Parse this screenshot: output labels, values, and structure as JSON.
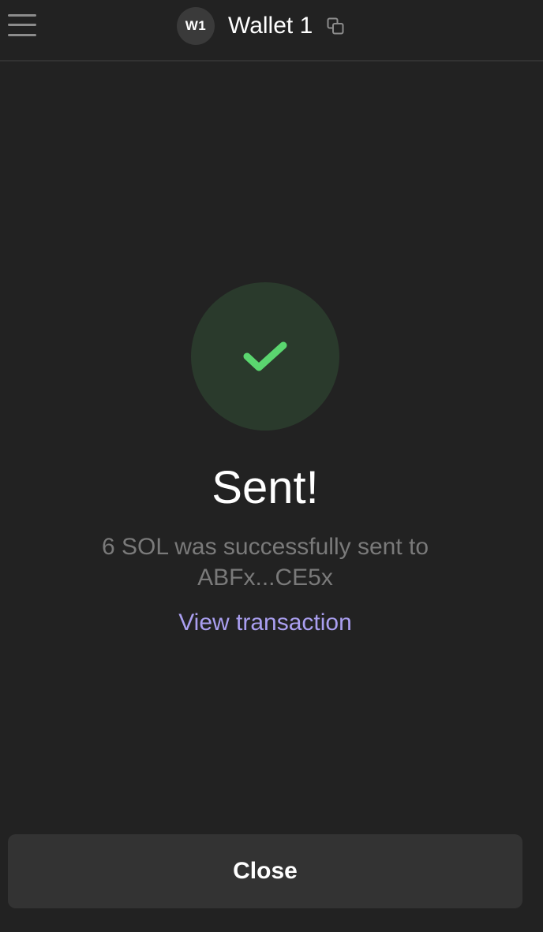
{
  "header": {
    "avatar_initials": "W1",
    "wallet_name": "Wallet 1",
    "menu_icon": "hamburger-menu-icon",
    "copy_icon": "copy-icon"
  },
  "result": {
    "status_icon": "checkmark-icon",
    "title": "Sent!",
    "message_line1": "6 SOL was successfully sent to",
    "message_line2": "ABFx...CE5x",
    "view_link": "View transaction"
  },
  "footer": {
    "close_label": "Close"
  },
  "colors": {
    "background": "#222222",
    "success_circle": "#2a3a2c",
    "checkmark": "#5ad66f",
    "link": "#aa9ff0",
    "muted_text": "#7a7a7a",
    "button_bg": "#333333"
  }
}
